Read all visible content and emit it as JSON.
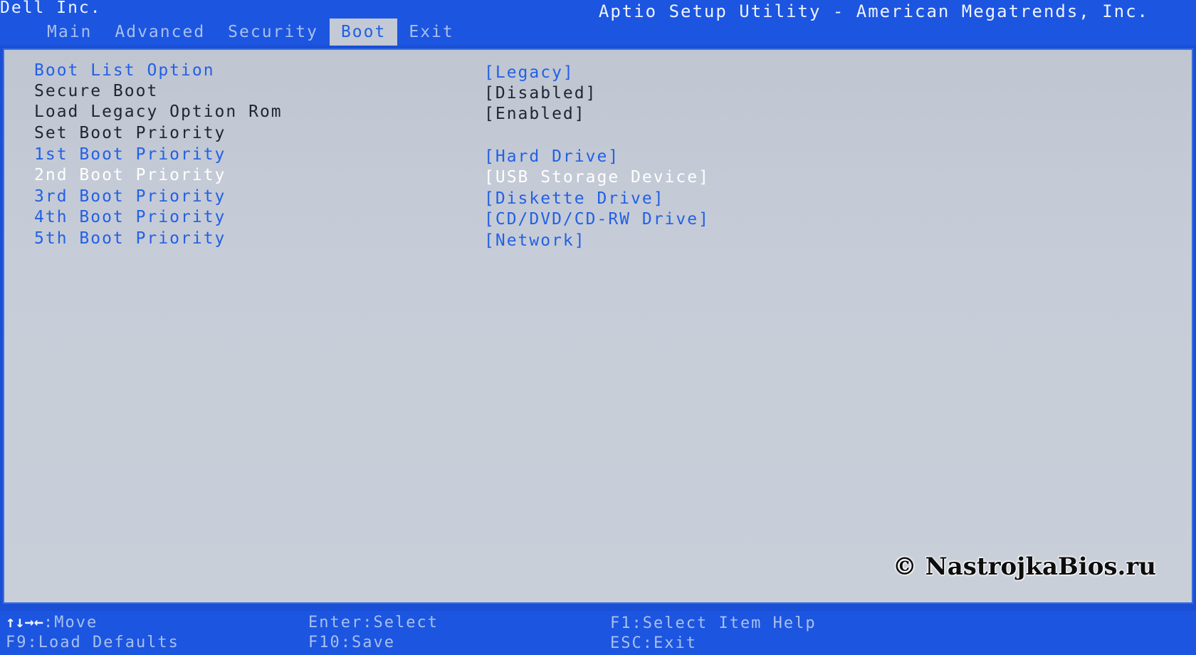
{
  "header": {
    "vendor": "Dell Inc.",
    "utility_title": "Aptio Setup Utility - American Megatrends, Inc.",
    "tabs": [
      {
        "label": "Main"
      },
      {
        "label": "Advanced"
      },
      {
        "label": "Security"
      },
      {
        "label": "Boot",
        "active": true
      },
      {
        "label": "Exit"
      }
    ]
  },
  "boot": {
    "items": [
      {
        "label": "Boot List Option",
        "value": "[Legacy]"
      },
      {
        "label": "Secure Boot",
        "value": "[Disabled]"
      },
      {
        "label": "Load Legacy Option Rom",
        "value": "[Enabled]"
      },
      {
        "label": "Set Boot Priority",
        "value": ""
      },
      {
        "label": "1st Boot Priority",
        "value": "[Hard Drive]"
      },
      {
        "label": "2nd Boot Priority",
        "value": "[USB Storage Device]",
        "selected": true
      },
      {
        "label": "3rd Boot Priority",
        "value": "[Diskette Drive]"
      },
      {
        "label": "4th Boot Priority",
        "value": "[CD/DVD/CD-RW Drive]"
      },
      {
        "label": "5th Boot Priority",
        "value": "[Network]"
      }
    ]
  },
  "watermark": "© NastrojkaBios.ru",
  "footer": {
    "move_arrows": "↑↓→←",
    "move": ":Move",
    "load_defaults": "F9:Load Defaults",
    "enter_select": "Enter:Select",
    "save": "F10:Save",
    "item_help": "F1:Select Item Help",
    "exit": "ESC:Exit"
  },
  "colors": {
    "bar_blue": "#1c55e0",
    "panel_gray": "#c5ccd7",
    "selectable_text": "#2360e6",
    "fixed_text": "#1e2630",
    "highlight_text": "#ffffff"
  }
}
